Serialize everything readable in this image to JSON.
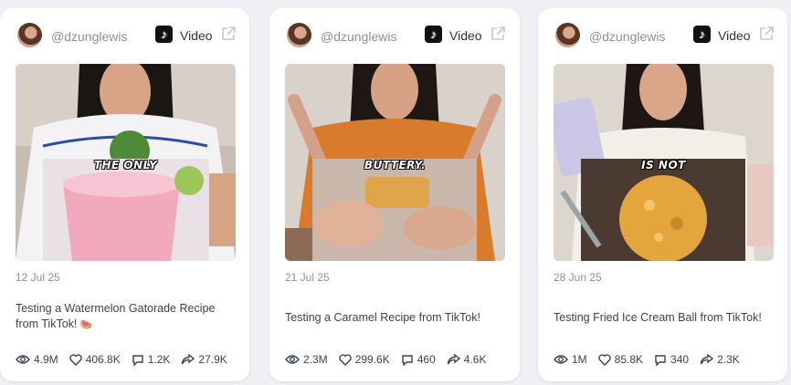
{
  "cards": [
    {
      "handle": "@dzunglewis",
      "type": "Video",
      "overlay_text": "THE ONLY",
      "date": "12 Jul 25",
      "title": "Testing a Watermelon Gatorade Recipe from TikTok!",
      "title_emoji": "🍉",
      "stats": {
        "views": "4.9M",
        "likes": "406.8K",
        "comments": "1.2K",
        "shares": "27.9K"
      }
    },
    {
      "handle": "@dzunglewis",
      "type": "Video",
      "overlay_text": "BUTTERY.",
      "date": "21 Jul 25",
      "title": "Testing a Caramel Recipe from TikTok!",
      "stats": {
        "views": "2.3M",
        "likes": "299.6K",
        "comments": "460",
        "shares": "4.6K"
      }
    },
    {
      "handle": "@dzunglewis",
      "type": "Video",
      "overlay_text": "IS NOT",
      "date": "28 Jun 25",
      "title": "Testing Fried Ice Cream Ball from TikTok!",
      "stats": {
        "views": "1M",
        "likes": "85.8K",
        "comments": "340",
        "shares": "2.3K"
      }
    }
  ],
  "icons": {
    "platform": "tiktok-icon",
    "external": "external-link-icon",
    "views": "eye-icon",
    "likes": "heart-icon",
    "comments": "comment-icon",
    "shares": "share-icon"
  },
  "colors": {
    "background": "#eef0f4",
    "card": "#ffffff",
    "muted_text": "#8a90a0",
    "text": "#3a4152"
  }
}
